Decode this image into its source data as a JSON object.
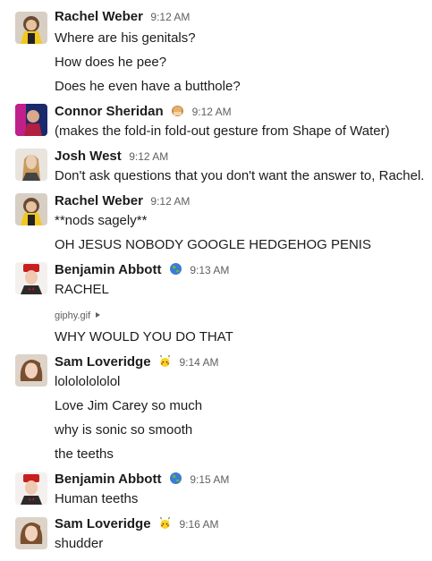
{
  "messages": [
    {
      "author": "Rachel Weber",
      "time": "9:12 AM",
      "lines": [
        "Where are his genitals?",
        "How does he pee?",
        "Does he even have a butthole?"
      ]
    },
    {
      "author": "Connor Sheridan",
      "status_emoji": "bread-emoji-icon",
      "time": "9:12 AM",
      "lines": [
        "(makes the fold-in fold-out gesture from Shape of Water)"
      ]
    },
    {
      "author": "Josh West",
      "time": "9:12 AM",
      "lines": [
        "Don't ask questions that you don't want the answer to, Rachel."
      ]
    },
    {
      "author": "Rachel Weber",
      "time": "9:12 AM",
      "lines": [
        "**nods sagely**",
        "OH JESUS NOBODY GOOGLE HEDGEHOG PENIS"
      ]
    },
    {
      "author": "Benjamin Abbott",
      "status_emoji": "globe-emoji-icon",
      "time": "9:13 AM",
      "lines": [
        "RACHEL"
      ],
      "attachment": "giphy.gif",
      "after_attachment": [
        "WHY WOULD YOU DO THAT"
      ]
    },
    {
      "author": "Sam Loveridge",
      "status_emoji": "pikachu-emoji-icon",
      "time": "9:14 AM",
      "lines": [
        "lolololololol",
        "Love Jim Carey so much",
        "why is sonic so smooth",
        "the teeths"
      ]
    },
    {
      "author": "Benjamin Abbott",
      "status_emoji": "globe-emoji-icon",
      "time": "9:15 AM",
      "lines": [
        "Human teeths"
      ]
    },
    {
      "author": "Sam Loveridge",
      "status_emoji": "pikachu-emoji-icon",
      "time": "9:16 AM",
      "lines": [
        "shudder"
      ]
    }
  ],
  "colors": {
    "author": "#1d1c1d",
    "timestamp": "#616061",
    "text": "#1d1c1d"
  }
}
